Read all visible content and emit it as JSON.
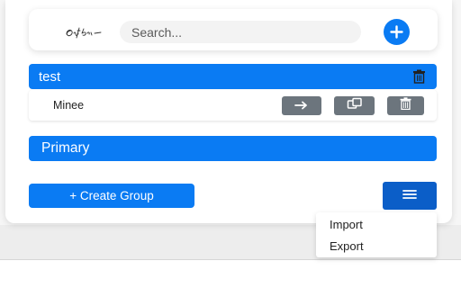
{
  "header": {
    "logo_text": "OffBit",
    "search_placeholder": "Search...",
    "search_value": "",
    "add_icon": "plus-icon"
  },
  "groups": [
    {
      "name": "test",
      "delete_icon": "trash-icon",
      "items": [
        {
          "label": "Minee",
          "actions": [
            "arrow-right-icon",
            "copy-icon",
            "trash-icon"
          ]
        }
      ]
    },
    {
      "name": "Primary",
      "items": []
    }
  ],
  "footer": {
    "create_group_label": "+ Create Group",
    "menu_icon": "hamburger-icon"
  },
  "dropdown": {
    "items": [
      "Import",
      "Export"
    ]
  },
  "colors": {
    "primary_blue": "#0a7bf3",
    "menu_blue": "#0b5ec8",
    "action_gray": "#6c757d"
  }
}
